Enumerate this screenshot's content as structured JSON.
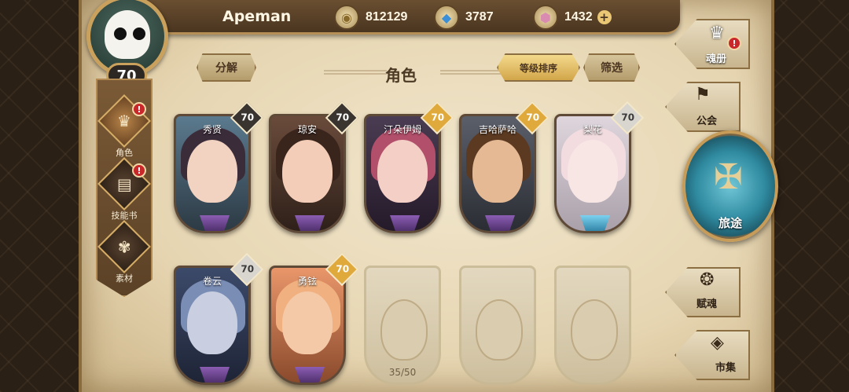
{
  "player": {
    "name": "Apeman",
    "level": "70"
  },
  "currencies": [
    {
      "icon": "gold-coin-icon",
      "value": "812129"
    },
    {
      "icon": "blue-crystal-icon",
      "value": "3787"
    },
    {
      "icon": "pink-gem-icon",
      "value": "1432"
    }
  ],
  "left_nav": [
    {
      "label": "角色",
      "icon": "character-icon",
      "alert": "!"
    },
    {
      "label": "技能书",
      "icon": "skill-book-icon",
      "alert": "!"
    },
    {
      "label": "素材",
      "icon": "material-icon"
    }
  ],
  "header": {
    "decompose_label": "分解",
    "title": "角色",
    "sort_label": "等级排序",
    "filter_label": "筛选"
  },
  "cards": [
    {
      "name": "秀贤",
      "level": "70",
      "badge": "dark",
      "gem": "purple",
      "face": "#f2d2c0",
      "hair": "#3b2c3a",
      "bg": "#5b7a8e"
    },
    {
      "name": "琼安",
      "level": "70",
      "badge": "dark",
      "gem": "purple",
      "face": "#f3cdb8",
      "hair": "#3a251d",
      "bg": "#6a4b3b"
    },
    {
      "name": "汀朵伊姆",
      "level": "70",
      "badge": "gold",
      "gem": "purple",
      "face": "#f4cfc6",
      "hair": "#b24f6b",
      "bg": "#4a3c52"
    },
    {
      "name": "吉哈萨哈",
      "level": "70",
      "badge": "gold",
      "gem": "purple",
      "face": "#e5b994",
      "hair": "#5c3a22",
      "bg": "#5b5f6a"
    },
    {
      "name": "梨花",
      "level": "70",
      "badge": "silver",
      "gem": "blue",
      "face": "#f8e6e4",
      "hair": "#f2dce0",
      "bg": "#dfd6dd"
    },
    {
      "name": "卷云",
      "level": "70",
      "badge": "silver",
      "gem": "purple",
      "face": "#c9cfe0",
      "hair": "#7a8db5",
      "bg": "#3c4a6a"
    },
    {
      "name": "勇铉",
      "level": "70",
      "badge": "gold",
      "gem": "purple",
      "face": "#f4c9a8",
      "hair": "#f0b07f",
      "bg": "#e9966a"
    }
  ],
  "locked_cards": [
    {
      "count": "35/50"
    },
    {
      "count": ""
    },
    {
      "count": ""
    }
  ],
  "right_nav": [
    {
      "label": "魂册",
      "icon": "soul-book-icon",
      "alert": "!"
    },
    {
      "label": "公会",
      "icon": "guild-icon"
    },
    {
      "label": "旅途",
      "icon": "journey-emblem-icon"
    },
    {
      "label": "赋魂",
      "icon": "spirit-swirl-icon"
    },
    {
      "label": "市集",
      "icon": "market-gem-icon"
    }
  ]
}
